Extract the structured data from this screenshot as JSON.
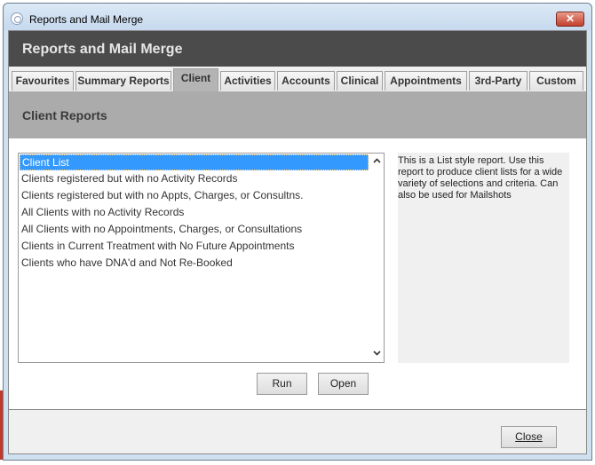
{
  "window": {
    "title": "Reports and Mail Merge",
    "close_glyph": "✕"
  },
  "header": {
    "title": "Reports and Mail Merge"
  },
  "tabs": [
    {
      "label": "Favourites",
      "active": false
    },
    {
      "label": "Summary Reports",
      "active": false
    },
    {
      "label": "Client",
      "active": true
    },
    {
      "label": "Activities",
      "active": false
    },
    {
      "label": "Accounts",
      "active": false
    },
    {
      "label": "Clinical",
      "active": false
    },
    {
      "label": "Appointments",
      "active": false
    },
    {
      "label": "3rd-Party",
      "active": false
    },
    {
      "label": "Custom",
      "active": false
    }
  ],
  "section": {
    "title": "Client Reports"
  },
  "reports": {
    "selected_index": 0,
    "items": [
      "Client List",
      "Clients registered but with no Activity Records",
      "Clients registered but with no Appts, Charges, or Consultns.",
      "All Clients with no Activity Records",
      "All Clients with no Appointments, Charges, or Consultations",
      "Clients in Current Treatment with No Future Appointments",
      "Clients who have DNA'd and Not Re-Booked"
    ]
  },
  "description": {
    "text": "This is a List style report. Use this report to produce client lists for a wide variety of selections and criteria. Can also be used for Mailshots"
  },
  "buttons": {
    "run": "Run",
    "open": "Open",
    "close": "Close"
  },
  "icons": {
    "scroll_up": "chevron-up-icon",
    "scroll_down": "chevron-down-icon",
    "app": "app-logo-icon"
  },
  "colors": {
    "header": "#4b4b4b",
    "section": "#ababab",
    "selection": "#3399ff",
    "close_button": "#c3402d"
  }
}
